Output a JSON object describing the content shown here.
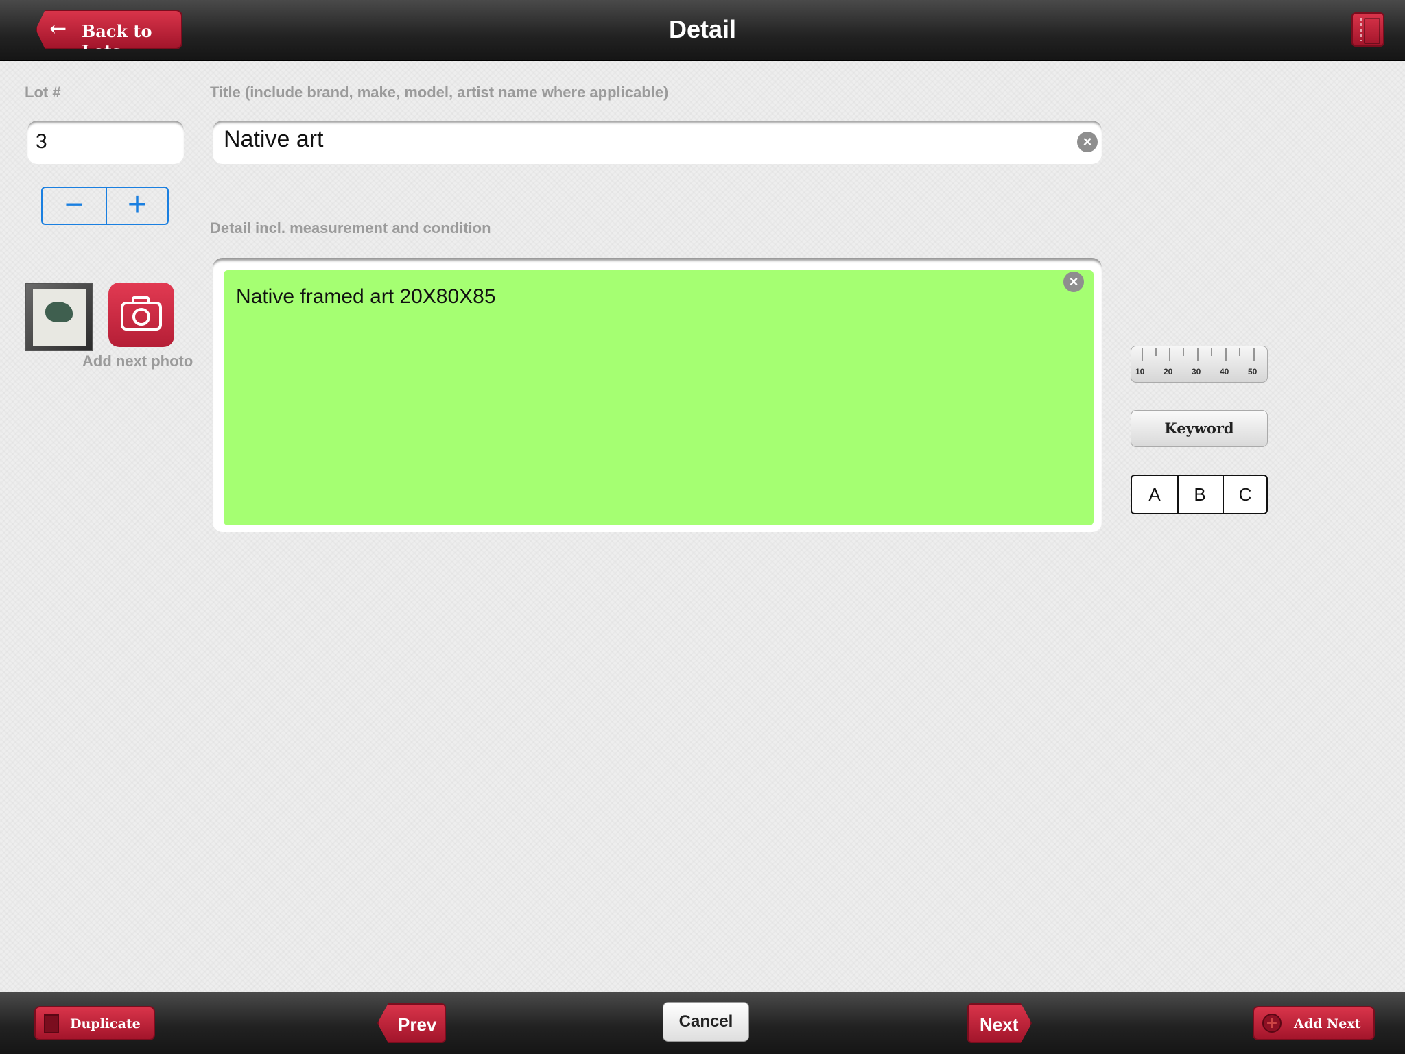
{
  "header": {
    "title": "Detail",
    "back_label": "Back to Lots"
  },
  "lot": {
    "label": "Lot #",
    "value": "3"
  },
  "title_field": {
    "label": "Title (include brand, make, model, artist name where applicable)",
    "value": "Native art"
  },
  "stepper": {
    "minus": "−",
    "plus": "+"
  },
  "detail_field": {
    "label": "Detail incl. measurement and condition",
    "value": "Native framed art 20X80X85",
    "highlight_color": "#a5ff72"
  },
  "photo": {
    "add_label": "Add next photo"
  },
  "side_tools": {
    "ruler_ticks": [
      "10",
      "20",
      "30",
      "40",
      "50"
    ],
    "keyword_label": "Keyword",
    "abc": [
      "A",
      "B",
      "C"
    ]
  },
  "footer": {
    "duplicate": "Duplicate",
    "prev": "Prev",
    "cancel": "Cancel",
    "next": "Next",
    "add_next": "Add Next"
  },
  "colors": {
    "accent_red": "#c0223a",
    "stepper_blue": "#1a7fe0"
  }
}
